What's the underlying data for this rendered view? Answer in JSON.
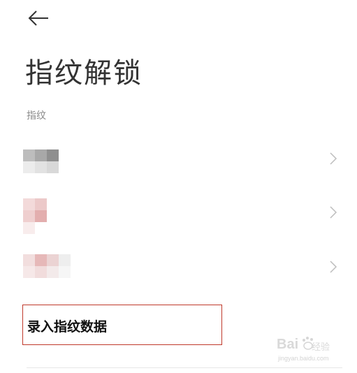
{
  "header": {
    "back_icon": "arrow-left-icon",
    "title": "指纹解锁"
  },
  "fingerprints": {
    "section_label": "指纹",
    "items": [
      {
        "name": "redacted",
        "icon": "chevron-right-icon"
      },
      {
        "name": "redacted",
        "icon": "chevron-right-icon"
      },
      {
        "name": "redacted",
        "icon": "chevron-right-icon"
      }
    ]
  },
  "enroll": {
    "label": "录入指纹数据",
    "highlight_color": "#c0392b"
  },
  "watermark": {
    "brand": "Bai",
    "suffix": "经验",
    "url": "jingyan.baidu.com"
  }
}
